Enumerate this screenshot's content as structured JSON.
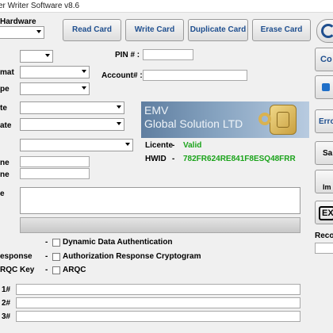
{
  "window": {
    "title": "er Writer Software v8.6"
  },
  "hardware_label": "Hardware",
  "toolbar": {
    "read_card": "Read Card",
    "write_card": "Write Card",
    "duplicate_card": "Duplicate Card",
    "erase_card": "Erase Card"
  },
  "form": {
    "pin_label": "PIN # :",
    "account_label": "Account# :",
    "label_format": "mat",
    "label_type": "pe",
    "label_start_date": "te",
    "label_end_date": "ate",
    "label_name1": "ne",
    "label_name2": "ne",
    "label_notes": "e"
  },
  "emv": {
    "line1": "EMV",
    "line2": "Global Solution LTD"
  },
  "license": {
    "licence_label": "Licente",
    "dash": "-",
    "licence_value": "Valid",
    "hwid_label": "HWID",
    "hwid_value": "782FR624RE841F8ESQ48FRR"
  },
  "options": {
    "row1_label": "",
    "row2_label": "esponse",
    "row3_label": "RQC Key",
    "dash": "-",
    "dda": "Dynamic Data Authentication",
    "arc": "Authorization Response Cryptogram",
    "arqc": "ARQC"
  },
  "tracks": {
    "track1_label": "1#",
    "track2_label": "2#",
    "track3_label": "3#"
  },
  "side": {
    "connect": "Co",
    "error": "Erro",
    "save": "Sa",
    "import": "Im",
    "exit": "EX",
    "record": "Reco"
  }
}
